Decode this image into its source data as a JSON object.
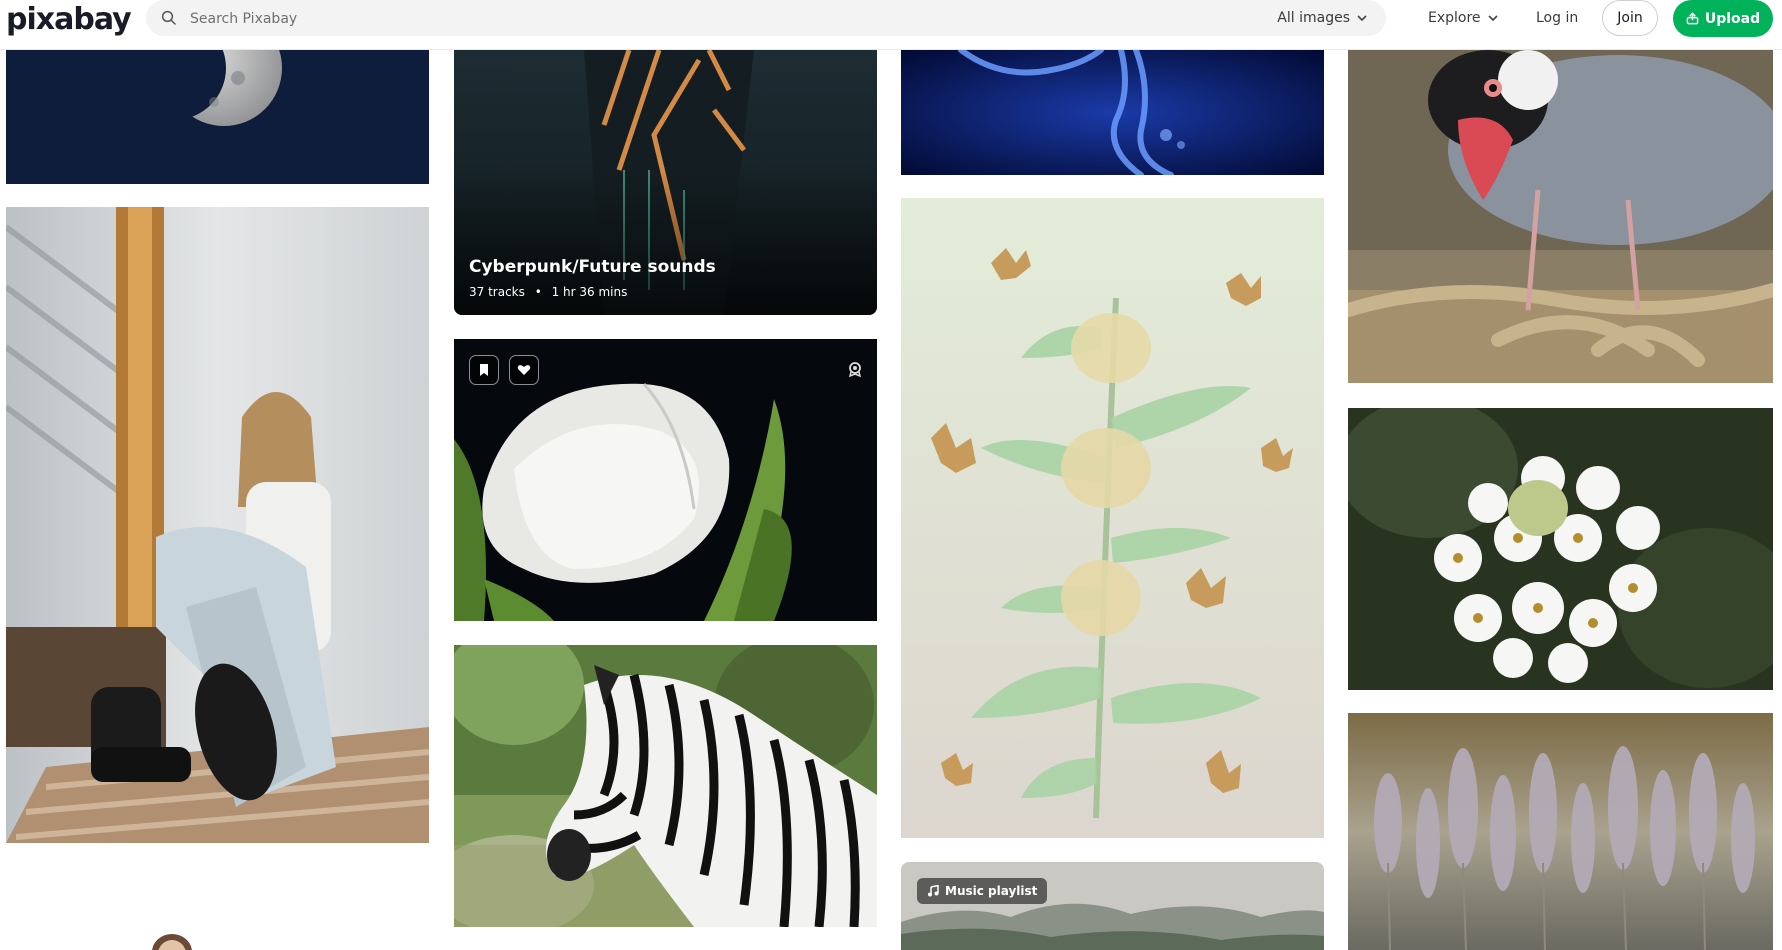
{
  "brand": {
    "logo_text": "pixabay"
  },
  "search": {
    "placeholder": "Search Pixabay",
    "filter_label": "All images"
  },
  "nav": {
    "explore_label": "Explore",
    "login_label": "Log in",
    "join_label": "Join",
    "upload_label": "Upload"
  },
  "icons": {
    "search": "search-icon",
    "chevron": "chevron-down-icon",
    "upload": "upload-icon",
    "bookmark": "bookmark-icon",
    "like": "heart-icon",
    "award": "award-badge-icon",
    "music": "music-note-icon"
  },
  "colors": {
    "brand_green": "#00b25a",
    "text_dark": "#191b26"
  },
  "playlist_card": {
    "title": "Cyberpunk/Future sounds",
    "tracks": "37 tracks",
    "separator": "•",
    "duration": "1 hr 36 mins"
  },
  "music_badge": {
    "label": "Music playlist"
  }
}
